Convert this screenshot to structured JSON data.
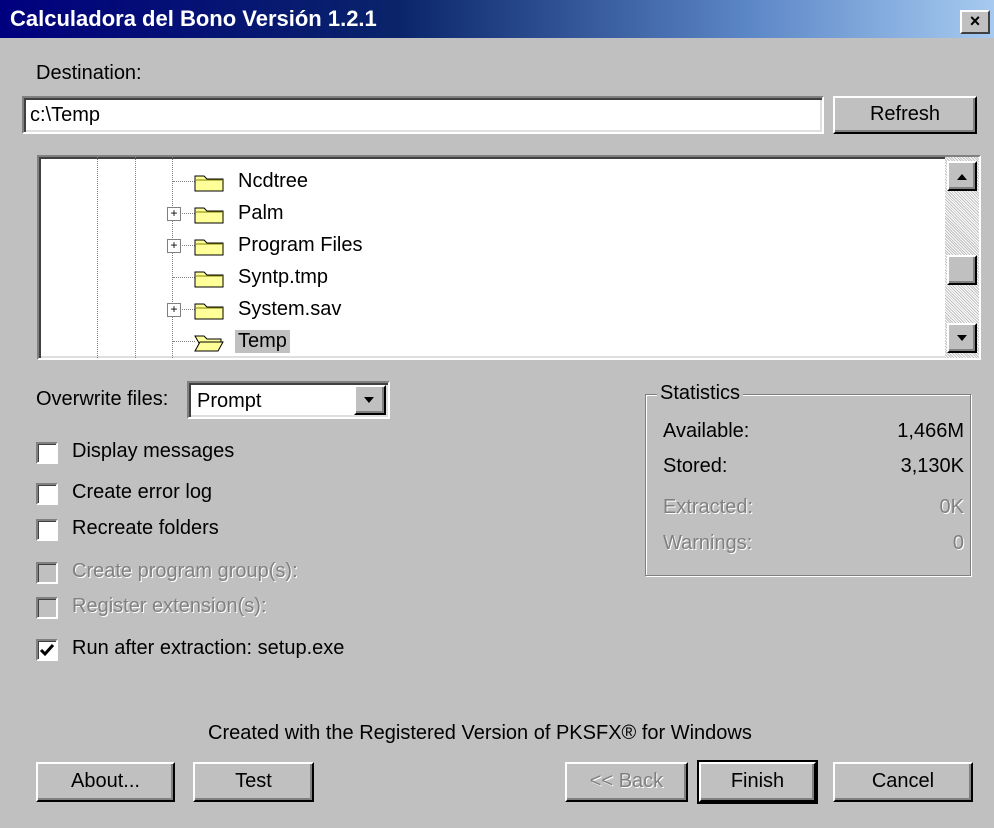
{
  "window": {
    "title": "Calculadora del Bono Versión 1.2.1",
    "close_label": "×"
  },
  "destination": {
    "label": "Destination:",
    "value": "c:\\Temp",
    "refresh_label": "Refresh"
  },
  "tree": {
    "items": [
      {
        "label": "Ncdtree",
        "expandable": false
      },
      {
        "label": "Palm",
        "expandable": true
      },
      {
        "label": "Program Files",
        "expandable": true
      },
      {
        "label": "Syntp.tmp",
        "expandable": false
      },
      {
        "label": "System.sav",
        "expandable": true
      },
      {
        "label": "Temp",
        "expandable": false,
        "selected": true,
        "open": true
      }
    ]
  },
  "overwrite": {
    "label": "Overwrite files:",
    "selected": "Prompt"
  },
  "options": [
    {
      "label": "Display messages",
      "checked": false,
      "enabled": true
    },
    {
      "label": "Create error log",
      "checked": false,
      "enabled": true
    },
    {
      "label": "Recreate folders",
      "checked": false,
      "enabled": true
    },
    {
      "label": "Create program group(s):",
      "checked": false,
      "enabled": false
    },
    {
      "label": "Register extension(s):",
      "checked": false,
      "enabled": false
    },
    {
      "label": "Run after extraction: setup.exe",
      "checked": true,
      "enabled": true
    }
  ],
  "statistics": {
    "title": "Statistics",
    "rows": [
      {
        "label": "Available:",
        "value": "1,466M",
        "enabled": true
      },
      {
        "label": "Stored:",
        "value": "3,130K",
        "enabled": true
      },
      {
        "label": "Extracted:",
        "value": "0K",
        "enabled": false
      },
      {
        "label": "Warnings:",
        "value": "0",
        "enabled": false
      }
    ]
  },
  "footer": {
    "credit": "Created with the Registered Version of PKSFX® for Windows"
  },
  "buttons": {
    "about": "About...",
    "test": "Test",
    "back": "<< Back",
    "finish": "Finish",
    "cancel": "Cancel"
  },
  "colors": {
    "face": "#c0c0c0",
    "title_start": "#00007e",
    "title_end": "#a6caf0",
    "disabled": "#808080",
    "folder": "#ffff99"
  }
}
